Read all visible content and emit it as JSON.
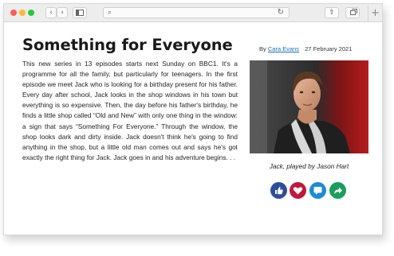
{
  "browser": {
    "nav_back_label": "‹",
    "nav_forward_label": "›",
    "search_icon_glyph": "⌕",
    "reload_icon_glyph": "↻",
    "share_icon_glyph": "⇧",
    "new_tab_label": "+"
  },
  "article": {
    "title": "Something for Everyone",
    "byline_prefix": "By",
    "author": "Cara Evans",
    "date": "27 February 2021",
    "body": "This new series in 13 episodes starts next Sunday on BBC1. It's a programme for all the family, but particularly for teenagers. In the first episode we meet Jack who is looking for a birthday present for his father. Every day after school, Jack looks in the shop windows in his town but everything is so expensive. Then, the day before his father's birthday, he finds a little shop called “Old and New” with only one thing in the window: a sign that says “Something For Everyone.” Through the window, the shop looks dark and dirty inside. Jack doesn't think he's going to find anything in the shop, but a little old man comes out and says he's got exactly the right thing for Jack. Jack goes in and his adventure begins. . .",
    "image_caption": "Jack, played by Jason Hart"
  },
  "social_buttons": [
    {
      "icon": "thumbs-up-icon",
      "color": "#2e4e9b"
    },
    {
      "icon": "heart-icon",
      "color": "#c0183c"
    },
    {
      "icon": "chat-bubble-icon",
      "color": "#1e8ad6"
    },
    {
      "icon": "share-arrow-icon",
      "color": "#1a9e5c"
    }
  ]
}
